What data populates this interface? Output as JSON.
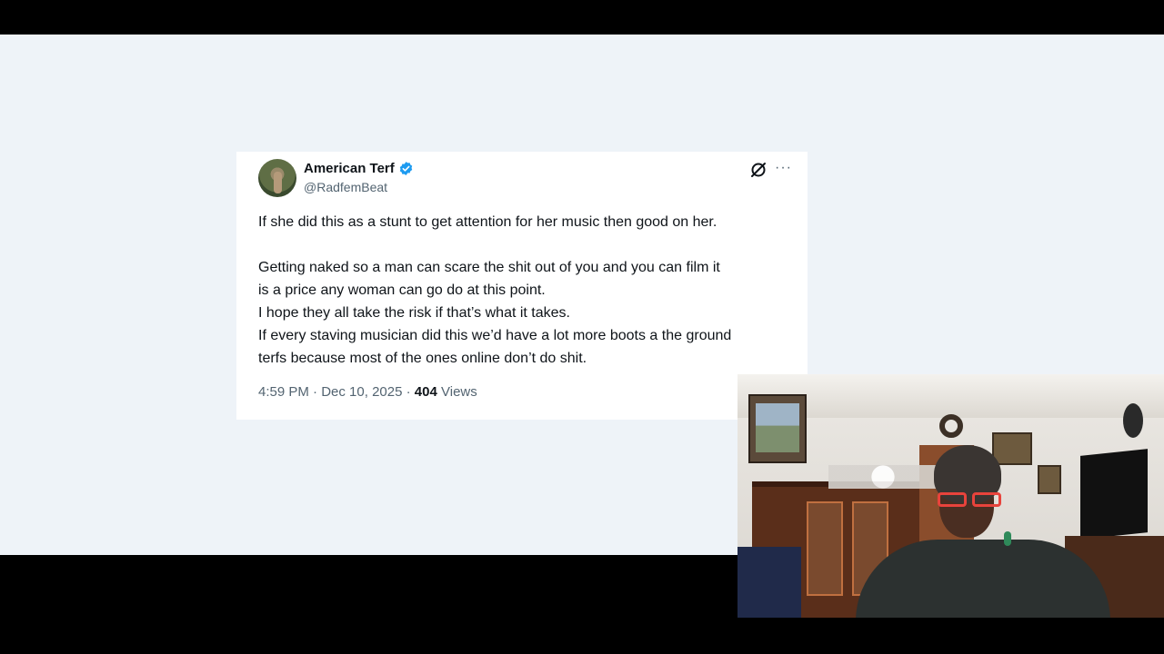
{
  "tweet": {
    "display_name": "American Terf",
    "handle": "@RadfemBeat",
    "verified_icon": "verified-badge-icon",
    "paragraph1": "If she did this as a stunt to get attention for her music then good on her.",
    "paragraph2_lines": [
      "Getting naked so a man can scare the shit out of you and you can film it",
      "is a price any woman can go do at this point.",
      "I hope they all take the risk if that’s what it takes.",
      "If every staving musician did this we’d have a lot more boots a the ground",
      "terfs because most of the ones online don’t do shit."
    ],
    "time": "4:59 PM",
    "separator": "·",
    "date": "Dec 10, 2025",
    "views_count": "404",
    "views_label": "Views",
    "more_label": "···"
  },
  "colors": {
    "stage_bg": "#eef3f8",
    "verified_blue": "#1d9bf0",
    "text": "#0f1419",
    "muted": "#536471"
  },
  "webcam": {
    "icon": "webcam-overlay"
  }
}
